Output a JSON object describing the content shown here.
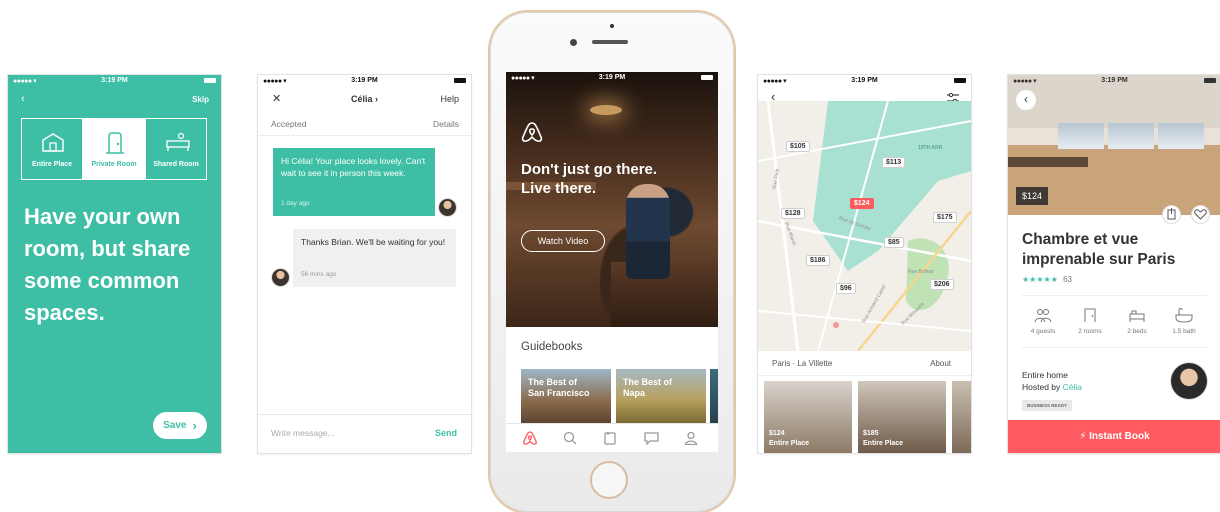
{
  "status_bar": {
    "time": "3:19 PM",
    "carrier": "●●●●● ▾"
  },
  "screen1": {
    "skip_label": "Skip",
    "segments": [
      {
        "label": "Entire Place",
        "icon": "house-icon"
      },
      {
        "label": "Private Room",
        "icon": "door-icon"
      },
      {
        "label": "Shared Room",
        "icon": "shared-bed-icon"
      }
    ],
    "headline": "Have your own room, but share some common spaces.",
    "save_label": "Save",
    "colors": {
      "teal": "#3ebfa5"
    }
  },
  "screen2": {
    "close_label": "✕",
    "title": "Célia ›",
    "help_label": "Help",
    "status": "Accepted",
    "details_label": "Details",
    "messages": [
      {
        "text": "Hi Célia! Your place looks lovely. Can't wait to see it in person this week.",
        "time": "1 day ago"
      },
      {
        "text": "Thanks Brian. We'll be waiting for you!",
        "time": "56 mins ago"
      }
    ],
    "input_placeholder": "Write message...",
    "send_label": "Send"
  },
  "screen3": {
    "headline_line1": "Don't just go there.",
    "headline_line2": "Live there.",
    "watch_video": "Watch Video",
    "section_title": "Guidebooks",
    "guidebooks": [
      {
        "line1": "The Best of",
        "line2": "San Francisco"
      },
      {
        "line1": "The Best of",
        "line2": "Napa"
      }
    ],
    "tabs": [
      "airbnb-tab-icon",
      "search-tab-icon",
      "trips-tab-icon",
      "messages-tab-icon",
      "profile-tab-icon"
    ],
    "accent": "#ff5a5f"
  },
  "screen4": {
    "pins": [
      "$105",
      "$113",
      "$124",
      "$128",
      "$175",
      "$85",
      "$186",
      "$96",
      "$206"
    ],
    "streets": [
      "Rue Petit",
      "Rue Manin",
      "Rue Bolivar",
      "19TH ARR",
      "Rue Mouzaïa",
      "Rue de Crimée",
      "Rue Armand Carrel"
    ],
    "location": "Paris · La Villette",
    "about_label": "About",
    "listings": [
      {
        "price": "$124",
        "type": "Entire Place"
      },
      {
        "price": "$185",
        "type": "Entire Place"
      }
    ]
  },
  "screen5": {
    "price": "$124",
    "title_line1": "Chambre et vue",
    "title_line2": "imprenable sur Paris",
    "stars": "★★★★★",
    "reviews": "63",
    "amenities": [
      {
        "label": "4 guests",
        "icon": "guests-icon"
      },
      {
        "label": "2 rooms",
        "icon": "rooms-icon"
      },
      {
        "label": "2 beds",
        "icon": "beds-icon"
      },
      {
        "label": "1.5 bath",
        "icon": "bath-icon"
      }
    ],
    "home_type": "Entire home",
    "hosted_by_prefix": "Hosted by ",
    "host_name": "Célia",
    "badge": "BUSINESS READY",
    "instant_book": "⚡ Instant Book"
  }
}
